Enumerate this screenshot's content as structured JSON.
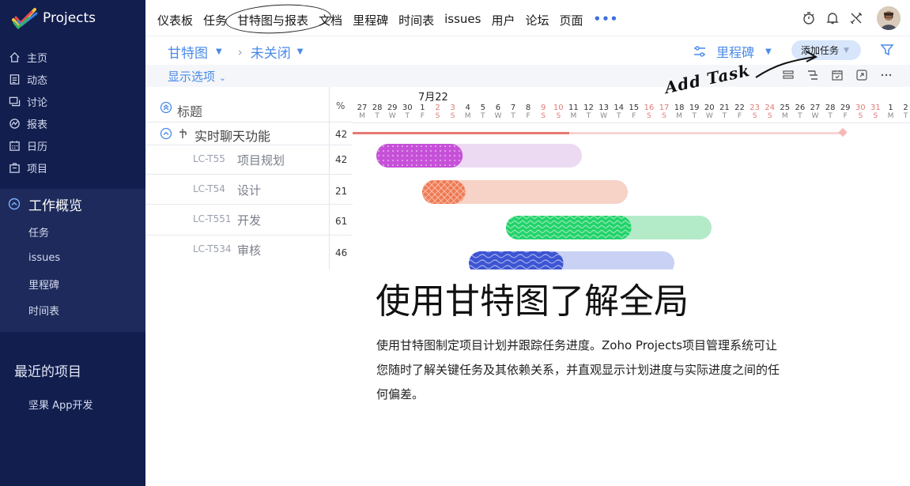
{
  "brand": {
    "name": "Projects"
  },
  "sidebar": {
    "items": [
      {
        "label": "主页",
        "icon": "home-icon"
      },
      {
        "label": "动态",
        "icon": "feed-icon"
      },
      {
        "label": "讨论",
        "icon": "discussion-icon"
      },
      {
        "label": "报表",
        "icon": "report-icon"
      },
      {
        "label": "日历",
        "icon": "calendar-icon"
      },
      {
        "label": "项目",
        "icon": "project-icon"
      }
    ],
    "section": {
      "title": "工作概览",
      "items": [
        "任务",
        "issues",
        "里程碑",
        "时间表"
      ]
    },
    "recent_title": "最近的项目",
    "recent_items": [
      "坚果 App开发"
    ]
  },
  "topnav": {
    "tabs": [
      "仪表板",
      "任务",
      "甘特图与报表",
      "文档",
      "里程碑",
      "时间表",
      "issues",
      "用户",
      "论坛",
      "页面"
    ],
    "active_tab": "甘特图与报表",
    "more": "•••"
  },
  "toolbar": {
    "view": "甘特图",
    "filter_sep": "›",
    "status": "未关闭",
    "milestone": "里程碑",
    "add_task": "添加任务",
    "show_options": "显示选项"
  },
  "annotation": {
    "text": "Add Task"
  },
  "gantt": {
    "title_col": "标题",
    "pct_col": "%",
    "month": "7月22",
    "days": [
      {
        "n": "27",
        "l": "M"
      },
      {
        "n": "28",
        "l": "T"
      },
      {
        "n": "29",
        "l": "W"
      },
      {
        "n": "30",
        "l": "T"
      },
      {
        "n": "1",
        "l": "F"
      },
      {
        "n": "2",
        "l": "S",
        "we": true
      },
      {
        "n": "3",
        "l": "S",
        "we": true
      },
      {
        "n": "4",
        "l": "M"
      },
      {
        "n": "5",
        "l": "T"
      },
      {
        "n": "6",
        "l": "W"
      },
      {
        "n": "7",
        "l": "T"
      },
      {
        "n": "8",
        "l": "F"
      },
      {
        "n": "9",
        "l": "S",
        "we": true
      },
      {
        "n": "10",
        "l": "S",
        "we": true
      },
      {
        "n": "11",
        "l": "M"
      },
      {
        "n": "12",
        "l": "T"
      },
      {
        "n": "13",
        "l": "W"
      },
      {
        "n": "14",
        "l": "T"
      },
      {
        "n": "15",
        "l": "F"
      },
      {
        "n": "16",
        "l": "S",
        "we": true
      },
      {
        "n": "17",
        "l": "S",
        "we": true
      },
      {
        "n": "18",
        "l": "M"
      },
      {
        "n": "19",
        "l": "T"
      },
      {
        "n": "20",
        "l": "W"
      },
      {
        "n": "21",
        "l": "T"
      },
      {
        "n": "22",
        "l": "F"
      },
      {
        "n": "23",
        "l": "S",
        "we": true
      },
      {
        "n": "24",
        "l": "S",
        "we": true
      },
      {
        "n": "25",
        "l": "M"
      },
      {
        "n": "26",
        "l": "T"
      },
      {
        "n": "27",
        "l": "W"
      },
      {
        "n": "28",
        "l": "T"
      },
      {
        "n": "29",
        "l": "F"
      },
      {
        "n": "30",
        "l": "S",
        "we": true
      },
      {
        "n": "31",
        "l": "S",
        "we": true
      },
      {
        "n": "1",
        "l": "M"
      },
      {
        "n": "2",
        "l": "T"
      }
    ],
    "parent": {
      "name": "实时聊天功能",
      "percent": "42",
      "progress": 0.42
    },
    "tasks": [
      {
        "id": "LC-T55",
        "name": "项目规划",
        "percent": "42",
        "progress": 0.42,
        "color": "#c651d8",
        "light": "#ecdaf3"
      },
      {
        "id": "LC-T54",
        "name": "设计",
        "percent": "21",
        "progress": 0.21,
        "color": "#ef7a53",
        "light": "#f7d2c6"
      },
      {
        "id": "LC-T551",
        "name": "开发",
        "percent": "61",
        "progress": 0.61,
        "color": "#22d36a",
        "light": "#b3ebc8"
      },
      {
        "id": "LC-T534",
        "name": "审核",
        "percent": "46",
        "progress": 0.46,
        "color": "#3d55d3",
        "light": "#c9d2f4"
      }
    ]
  },
  "hero": {
    "title": "使用甘特图了解全局",
    "desc": "使用甘特图制定项目计划并跟踪任务进度。Zoho Projects项目管理系统可让您随时了解关键任务及其依赖关系，并直观显示计划进度与实际进度之间的任何偏差。"
  },
  "colors": {
    "sidebar": "#121e4e",
    "accent": "#4a8ae8",
    "parent_bar": "#e87872"
  }
}
